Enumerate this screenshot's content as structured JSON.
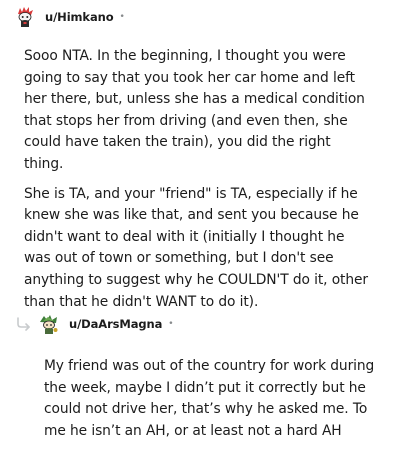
{
  "comments": [
    {
      "username": "u/Himkano",
      "separator": "•",
      "avatar_icon": "snoo-avatar-red-hair",
      "paragraphs": [
        "Sooo NTA. In the beginning, I thought you were going to say that you took her car home and left her there, but, unless she has a medical condition that stops her from driving (and even then, she could have taken the train), you did the right thing.",
        "She is TA, and your \"friend\" is TA, especially if he knew she was like that, and sent you because he didn't want to deal with it (initially I thought he was out of town or something, but I don't see anything to suggest why he COULDN'T do it, other than that he didn't WANT to do it)."
      ]
    },
    {
      "username": "u/DaArsMagna",
      "separator": "•",
      "avatar_icon": "snoo-avatar-green-hat",
      "reply_icon": "reply-arrow-icon",
      "paragraphs": [
        "My friend was out of the country for work during the week, maybe I didn’t put it correctly but he could not drive her, that’s why he asked me. To me he isn’t an AH, or at least not a hard AH"
      ]
    }
  ],
  "colors": {
    "text": "#1c1c1c",
    "meta": "#878a8c",
    "reply_line": "#c8cbcd"
  }
}
